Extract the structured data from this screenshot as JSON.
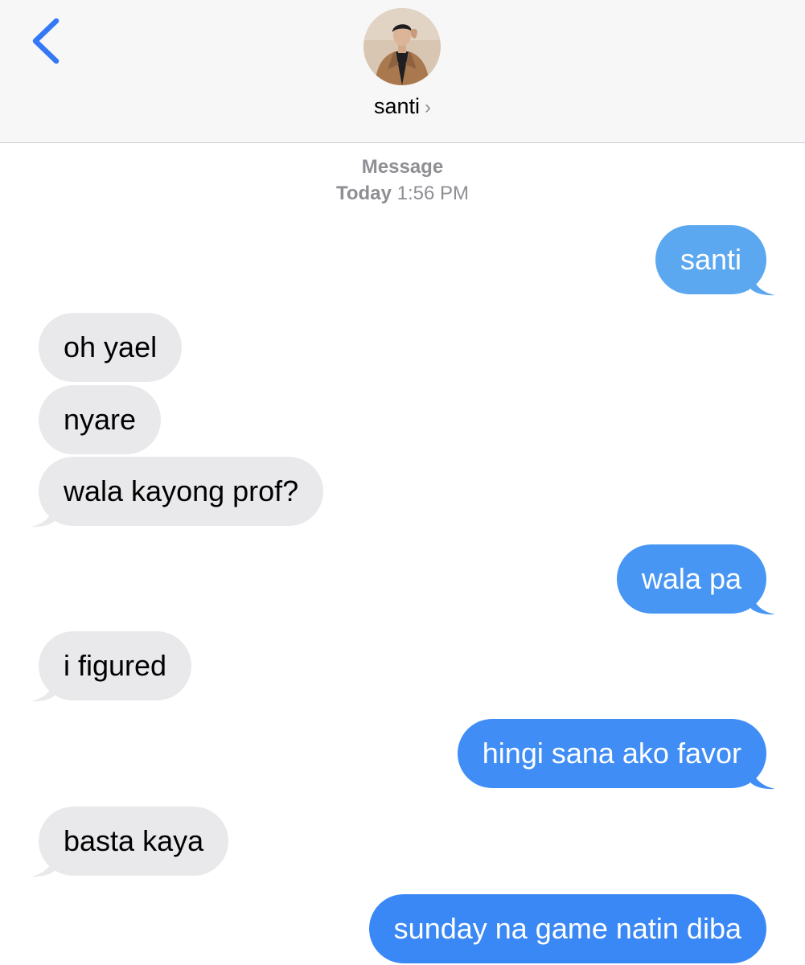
{
  "header": {
    "back_icon": "chevron-left-icon",
    "contact_name": "santi",
    "contact_chevron": "›",
    "avatar_icon": "contact-photo"
  },
  "service_label": "Message",
  "timestamp": {
    "day": "Today",
    "time": "1:56 PM"
  },
  "colors": {
    "accent": "#3478f6",
    "sent_light": "#5ca8f0",
    "sent": "#3f8df5",
    "received": "#e9e9eb"
  },
  "messages": [
    {
      "dir": "sent",
      "text": "santi"
    },
    {
      "dir": "received",
      "text": "oh yael"
    },
    {
      "dir": "received",
      "text": "nyare"
    },
    {
      "dir": "received",
      "text": "wala kayong prof?"
    },
    {
      "dir": "sent",
      "text": "wala pa"
    },
    {
      "dir": "received",
      "text": "i figured"
    },
    {
      "dir": "sent",
      "text": "hingi sana ako favor"
    },
    {
      "dir": "received",
      "text": "basta kaya"
    },
    {
      "dir": "sent",
      "text": "sunday na game natin diba"
    }
  ]
}
